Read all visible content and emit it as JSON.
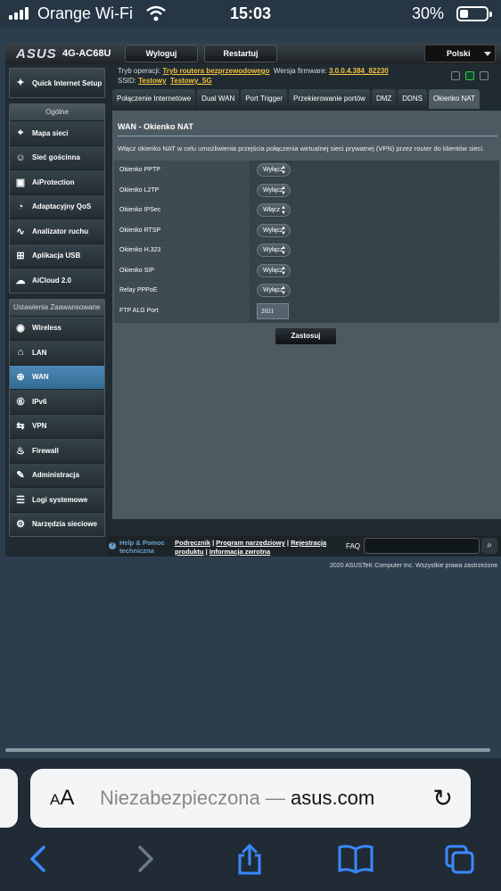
{
  "status_bar": {
    "carrier": "Orange Wi-Fi",
    "time": "15:03",
    "battery": "30%",
    "battery_level": 0.3
  },
  "router": {
    "brand": "ASUS",
    "model": "4G-AC68U",
    "top_buttons": {
      "logout": "Wyloguj",
      "restart": "Restartuj"
    },
    "language": "Polski",
    "info": {
      "mode_label": "Tryb operacji:",
      "mode_value": "Tryb routera bezprzewodowego",
      "fw_label": "Wersja firmware:",
      "fw_value": "3.0.0.4.384_82230",
      "ssid_label": "SSID:",
      "ssid1": "Testowy",
      "ssid2": "Testowy_5G"
    },
    "sidebar": {
      "qis": "Quick Internet Setup",
      "general_head": "Ogólne",
      "general": [
        {
          "label": "Mapa sieci",
          "icon": "network-map-icon",
          "glyph": "⌖"
        },
        {
          "label": "Sieć gościnna",
          "icon": "guest-network-icon",
          "glyph": "☺"
        },
        {
          "label": "AiProtection",
          "icon": "aiprotection-lock-icon",
          "glyph": "▣"
        },
        {
          "label": "Adaptacyjny QoS",
          "icon": "qos-gauge-icon",
          "glyph": "◔"
        },
        {
          "label": "Analizator ruchu",
          "icon": "traffic-analyzer-icon",
          "glyph": "∿"
        },
        {
          "label": "Aplikacja USB",
          "icon": "usb-app-icon",
          "glyph": "⊞"
        },
        {
          "label": "AiCloud 2.0",
          "icon": "aicloud-icon",
          "glyph": "☁"
        }
      ],
      "advanced_head": "Ustawienia Zaawansowane",
      "advanced": [
        {
          "label": "Wireless",
          "icon": "wireless-icon",
          "glyph": "◉"
        },
        {
          "label": "LAN",
          "icon": "lan-icon",
          "glyph": "⌂"
        },
        {
          "label": "WAN",
          "icon": "wan-globe-icon",
          "glyph": "⊕",
          "active": true
        },
        {
          "label": "IPv6",
          "icon": "ipv6-icon",
          "glyph": "⑥"
        },
        {
          "label": "VPN",
          "icon": "vpn-icon",
          "glyph": "⇆"
        },
        {
          "label": "Firewall",
          "icon": "firewall-icon",
          "glyph": "♨"
        },
        {
          "label": "Administracja",
          "icon": "administration-icon",
          "glyph": "✎"
        },
        {
          "label": "Logi systemowe",
          "icon": "system-log-icon",
          "glyph": "☰"
        },
        {
          "label": "Narzędzia sieciowe",
          "icon": "network-tools-icon",
          "glyph": "⚙"
        }
      ]
    },
    "tabs": [
      "Połączenie Internetowe",
      "Dual WAN",
      "Port Trigger",
      "Przekierowanie portów",
      "DMZ",
      "DDNS",
      "Okienko NAT"
    ],
    "active_tab": 6,
    "panel": {
      "title": "WAN - Okienko NAT",
      "description": "Włącz okienko NAT w celu umożliwienia przejścia połączenia wirtualnej sieci prywatnej (VPN) przez router do klientów sieci.",
      "rows": [
        {
          "label": "Okienko PPTP",
          "value": "Wyłącz"
        },
        {
          "label": "Okienko L2TP",
          "value": "Wyłącz"
        },
        {
          "label": "Okienko IPSec",
          "value": "Włącz"
        },
        {
          "label": "Okienko RTSP",
          "value": "Wyłącz"
        },
        {
          "label": "Okienko H.323",
          "value": "Wyłącz"
        },
        {
          "label": "Okienko SIP",
          "value": "Wyłącz"
        },
        {
          "label": "Relay PPPoE",
          "value": "Wyłącz"
        }
      ],
      "ftp_label": "FTP ALG Port",
      "ftp_value": "2021",
      "apply": "Zastosuj"
    },
    "footer": {
      "help1": "Help & Pomoc",
      "help2": "techniczna",
      "link1": "Podręcznik",
      "link2": "Program narzędziowy",
      "link3": "Rejestracja",
      "link4": "produktu",
      "link5": "Informacja zwrotna",
      "faq": "FAQ"
    },
    "copyright": "2020 ASUSTeK Computer Inc. Wszystkie prawa zastrzeżone"
  },
  "safari": {
    "aa": "AA",
    "url_prefix": "Niezabezpieczona — ",
    "url_domain": "asus.com"
  }
}
